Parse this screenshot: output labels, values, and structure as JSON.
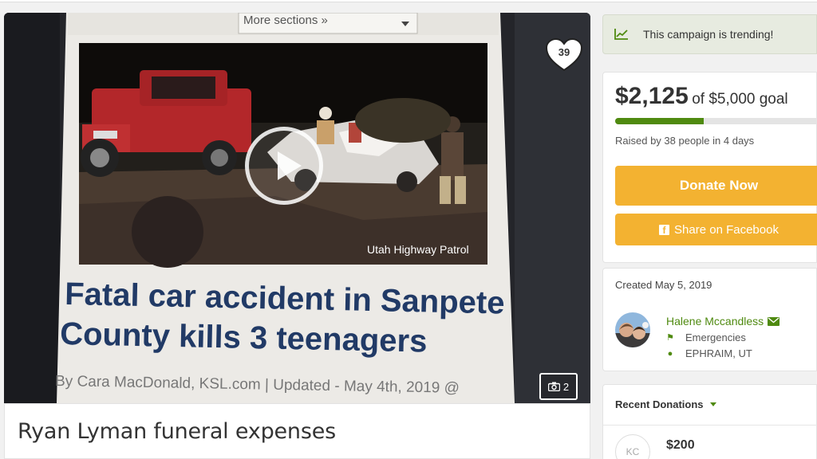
{
  "media": {
    "screenshot_header": "More sections »",
    "photo_credit": "Utah Highway Patrol",
    "headline_line1": "Fatal car accident in Sanpete",
    "headline_line2": "County kills 3 teenagers",
    "byline": "By Cara MacDonald, KSL.com | Updated - May 4th, 2019 @",
    "heart_count": "39",
    "photo_count": "2"
  },
  "campaign": {
    "title": "Ryan Lyman funeral expenses"
  },
  "trending": {
    "text": "This campaign is trending!",
    "icon": "trend-chart-icon"
  },
  "goal": {
    "raised_amount": "$2,125",
    "goal_text": "of $5,000 goal",
    "progress_fraction": 0.425,
    "raised_by": "Raised by 38 people in 4 days",
    "donate_label": "Donate Now",
    "share_label": "Share on Facebook",
    "accent_color": "#f3b231",
    "progress_color": "#4f8a10"
  },
  "organizer": {
    "created": "Created May 5, 2019",
    "name": "Halene Mccandless",
    "category": "Emergencies",
    "location": "EPHRAIM, UT"
  },
  "donations": {
    "header": "Recent Donations",
    "first_initials": "KC",
    "first_amount": "$200"
  }
}
